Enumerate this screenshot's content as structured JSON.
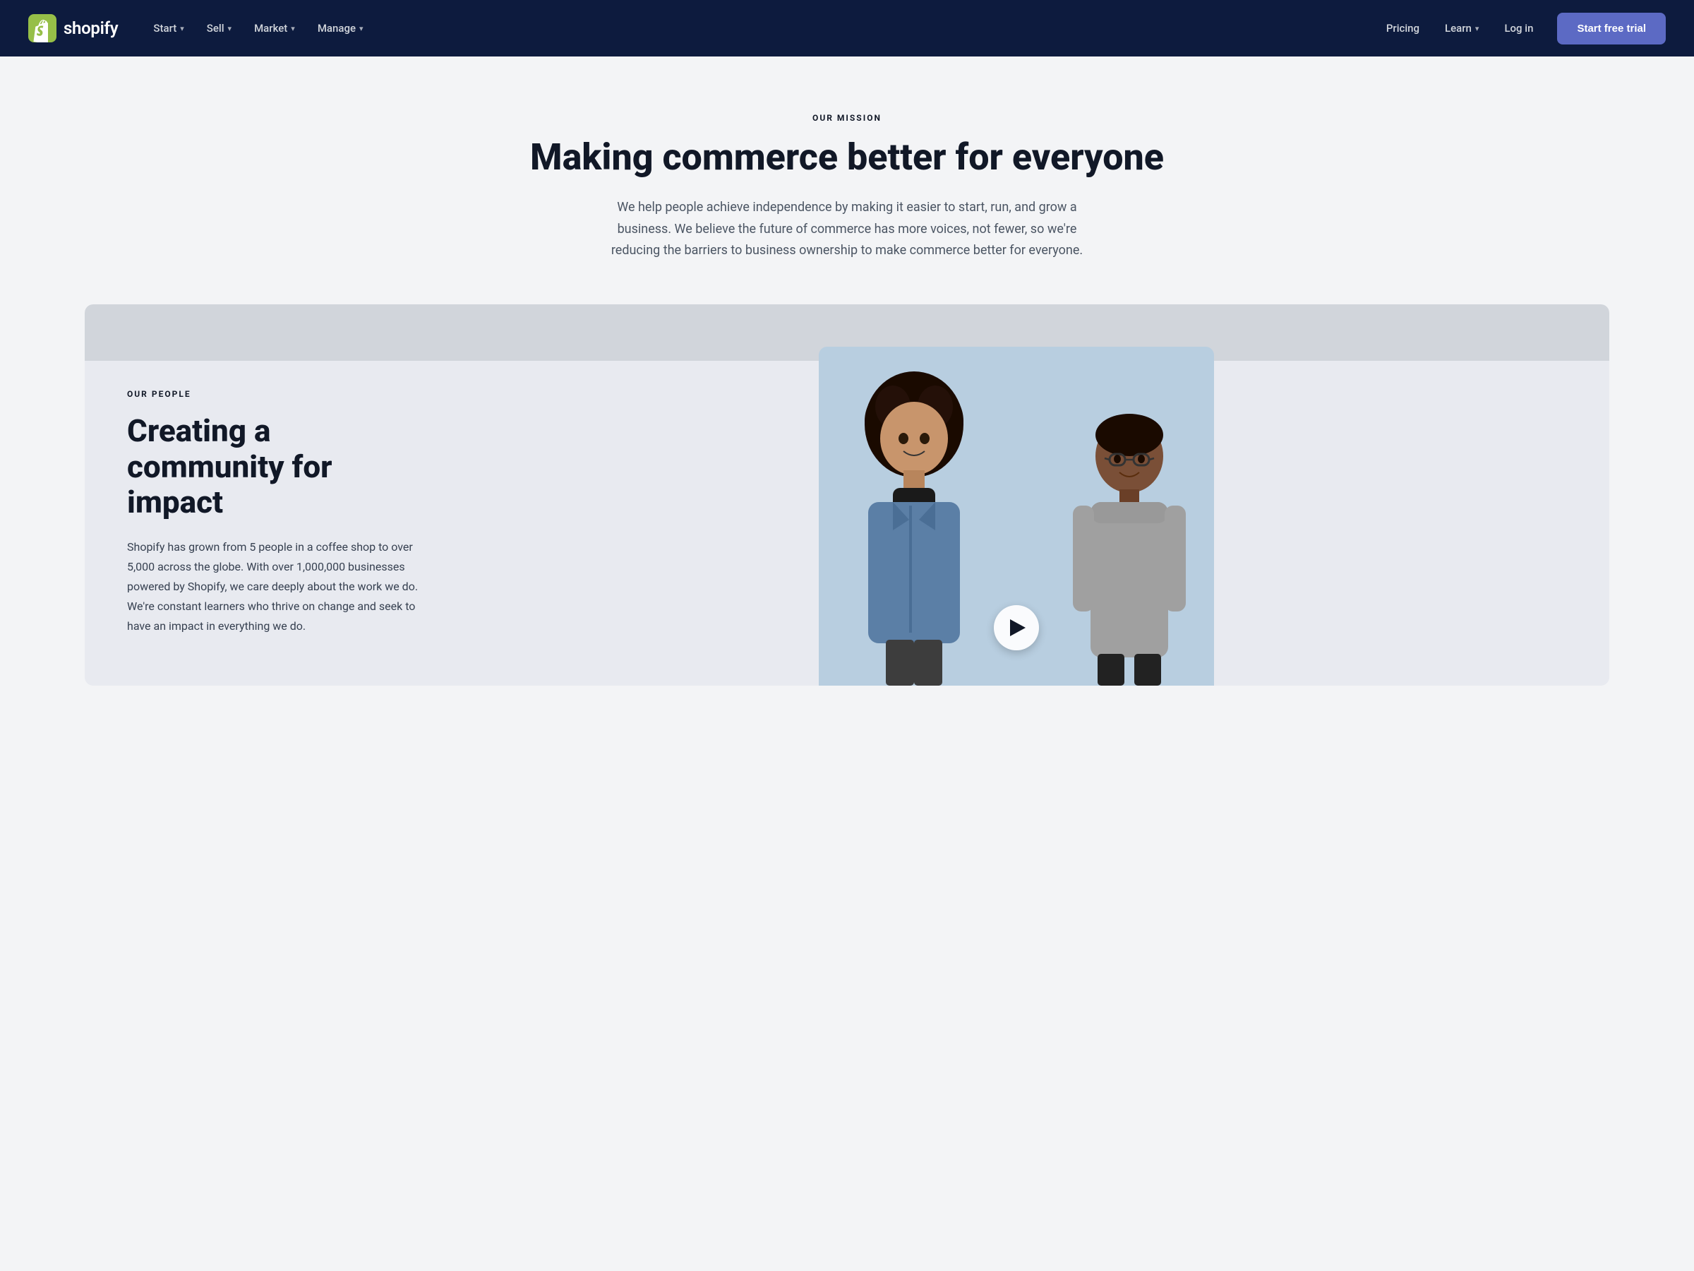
{
  "nav": {
    "logo_text": "shopify",
    "primary_items": [
      {
        "label": "Start",
        "has_dropdown": true
      },
      {
        "label": "Sell",
        "has_dropdown": true
      },
      {
        "label": "Market",
        "has_dropdown": true
      },
      {
        "label": "Manage",
        "has_dropdown": true
      }
    ],
    "secondary_items": [
      {
        "label": "Pricing",
        "has_dropdown": false
      },
      {
        "label": "Learn",
        "has_dropdown": true
      }
    ],
    "login_label": "Log in",
    "cta_label": "Start free trial"
  },
  "mission": {
    "section_label": "OUR MISSION",
    "heading": "Making commerce better for everyone",
    "body": "We help people achieve independence by making it easier to start, run, and grow a business. We believe the future of commerce has more voices, not fewer, so we're reducing the barriers to business ownership to make commerce better for everyone."
  },
  "people": {
    "section_label": "OUR PEOPLE",
    "heading": "Creating a community for impact",
    "body": "Shopify has grown from 5 people in a coffee shop to over 5,000 across the globe. With over 1,000,000 businesses powered by Shopify, we care deeply about the work we do. We're constant learners who thrive on change and seek to have an impact in everything we do.",
    "play_button_label": "Play video"
  }
}
